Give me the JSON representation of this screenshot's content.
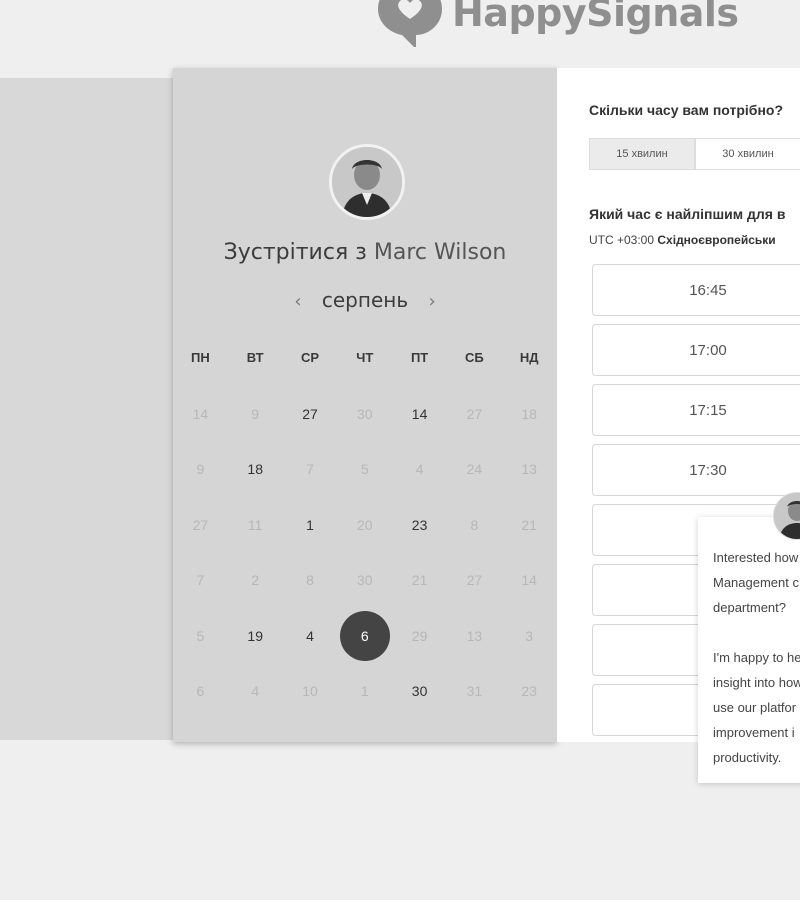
{
  "brand": {
    "name": "HappySignals"
  },
  "calendar": {
    "title_prefix": "Зустрітися з",
    "host_name": "Marc Wilson",
    "month": "серпень",
    "prev_arrow": "‹",
    "next_arrow": "›",
    "weekdays": [
      "ПН",
      "ВТ",
      "СР",
      "ЧТ",
      "ПТ",
      "СБ",
      "НД"
    ],
    "weeks": [
      [
        {
          "d": "14",
          "s": "muted"
        },
        {
          "d": "9",
          "s": "muted"
        },
        {
          "d": "27",
          "s": "active"
        },
        {
          "d": "30",
          "s": "muted"
        },
        {
          "d": "14",
          "s": "active"
        },
        {
          "d": "27",
          "s": "muted"
        },
        {
          "d": "18",
          "s": "muted"
        }
      ],
      [
        {
          "d": "9",
          "s": "muted"
        },
        {
          "d": "18",
          "s": "active"
        },
        {
          "d": "7",
          "s": "muted"
        },
        {
          "d": "5",
          "s": "muted"
        },
        {
          "d": "4",
          "s": "muted"
        },
        {
          "d": "24",
          "s": "muted"
        },
        {
          "d": "13",
          "s": "muted"
        }
      ],
      [
        {
          "d": "27",
          "s": "muted"
        },
        {
          "d": "11",
          "s": "muted"
        },
        {
          "d": "1",
          "s": "active"
        },
        {
          "d": "20",
          "s": "muted"
        },
        {
          "d": "23",
          "s": "active"
        },
        {
          "d": "8",
          "s": "muted"
        },
        {
          "d": "21",
          "s": "muted"
        }
      ],
      [
        {
          "d": "7",
          "s": "muted"
        },
        {
          "d": "2",
          "s": "muted"
        },
        {
          "d": "8",
          "s": "muted"
        },
        {
          "d": "30",
          "s": "muted"
        },
        {
          "d": "21",
          "s": "muted"
        },
        {
          "d": "27",
          "s": "muted"
        },
        {
          "d": "14",
          "s": "muted"
        }
      ],
      [
        {
          "d": "5",
          "s": "muted"
        },
        {
          "d": "19",
          "s": "active"
        },
        {
          "d": "4",
          "s": "active"
        },
        {
          "d": "6",
          "s": "selected"
        },
        {
          "d": "29",
          "s": "muted"
        },
        {
          "d": "13",
          "s": "muted"
        },
        {
          "d": "3",
          "s": "muted"
        }
      ],
      [
        {
          "d": "6",
          "s": "muted"
        },
        {
          "d": "4",
          "s": "muted"
        },
        {
          "d": "10",
          "s": "muted"
        },
        {
          "d": "1",
          "s": "muted"
        },
        {
          "d": "30",
          "s": "active"
        },
        {
          "d": "31",
          "s": "muted"
        },
        {
          "d": "23",
          "s": "muted"
        }
      ]
    ]
  },
  "booking": {
    "duration_question": "Скільки часу вам потрібно?",
    "durations": [
      "15 хвилин",
      "30 хвилин"
    ],
    "time_question": "Який час є найліпшим для в",
    "timezone_offset": "UTC +03:00",
    "timezone_name": "Східноєвропейськи",
    "slots": [
      "16:45",
      "17:00",
      "17:15",
      "17:30",
      "",
      "",
      ""
    ]
  },
  "chat": {
    "message_1": "Interested how\nManagement c\ndepartment?",
    "message_2": "I'm happy to he\ninsight into how\nuse our platfor\nimprovement i\nproductivity."
  }
}
